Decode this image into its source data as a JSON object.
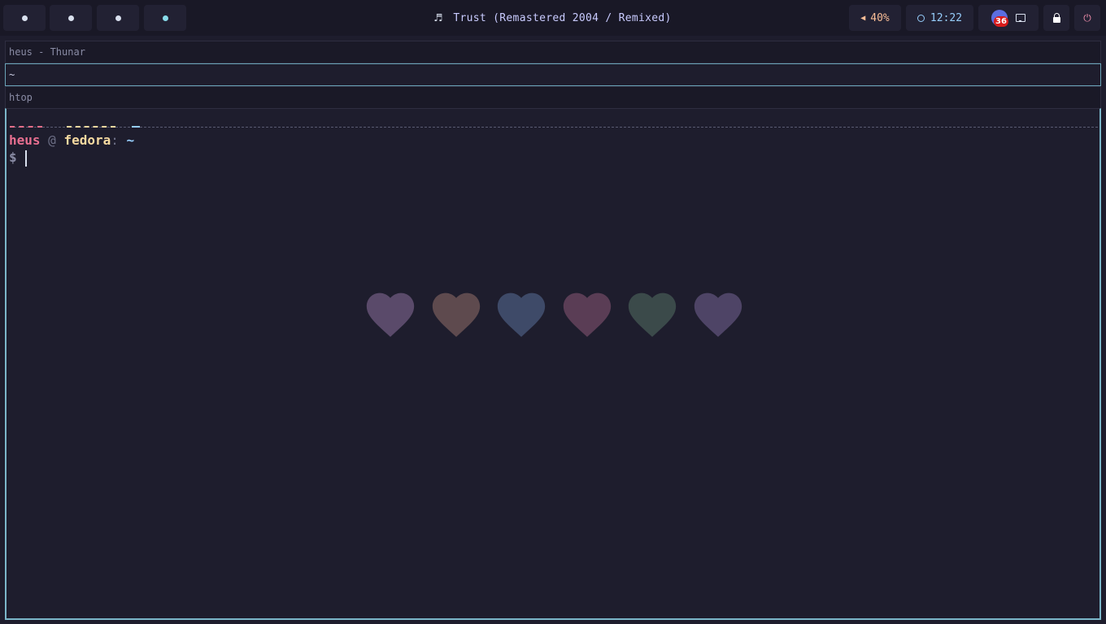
{
  "topbar": {
    "workspaces": [
      {
        "label": "",
        "active": false
      },
      {
        "label": "",
        "active": false
      },
      {
        "label": "",
        "active": false
      },
      {
        "label": "",
        "active": true
      }
    ],
    "music": {
      "icon": "music-note-icon",
      "title": "Trust (Remastered 2004 / Remixed)"
    },
    "volume": {
      "icon": "speaker-icon",
      "value": "40%"
    },
    "clock": {
      "icon": "clock-icon",
      "time": "12:22"
    },
    "tray": {
      "badge_count": "36",
      "icons": [
        "app-badge-icon",
        "network-icon"
      ]
    },
    "lock": {
      "icon": "lock-icon"
    },
    "power": {
      "icon": "power-icon",
      "glyph": "⏻"
    }
  },
  "windows": [
    {
      "title": "heus - Thunar",
      "focused": false
    },
    {
      "title": "~",
      "focused": true
    },
    {
      "title": "htop",
      "focused": false
    }
  ],
  "terminal": {
    "user": "heus",
    "at": "@",
    "host": "fedora",
    "colon": ":",
    "path": "~",
    "shell_symbol": "$",
    "hearts": [
      {
        "color": "#5a4a6a"
      },
      {
        "color": "#5e4a4e"
      },
      {
        "color": "#3e4a68"
      },
      {
        "color": "#5a3d55"
      },
      {
        "color": "#3b4a4a"
      },
      {
        "color": "#4e4466"
      }
    ]
  },
  "colors": {
    "background": "#1e1d2d",
    "accent": "#7bb6c9",
    "pink": "#e86f90",
    "peach": "#f5d9a0",
    "blue": "#96cdfb"
  }
}
